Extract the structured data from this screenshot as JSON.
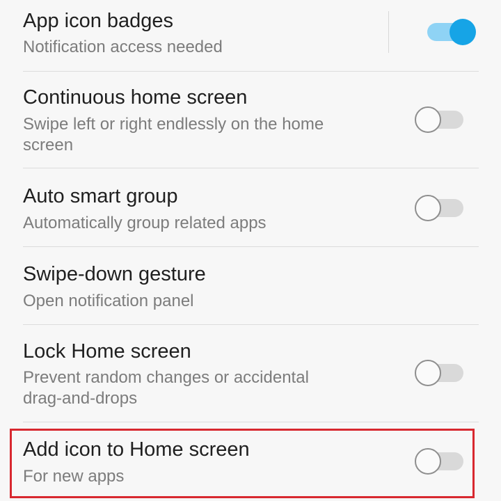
{
  "settings": {
    "items": [
      {
        "title": "App icon badges",
        "subtitle": "Notification access needed",
        "toggle": "on"
      },
      {
        "title": "Continuous home screen",
        "subtitle": "Swipe left or right endlessly on the home screen",
        "toggle": "off"
      },
      {
        "title": "Auto smart group",
        "subtitle": "Automatically group related apps",
        "toggle": "off"
      },
      {
        "title": "Swipe-down gesture",
        "subtitle": "Open notification panel"
      },
      {
        "title": "Lock Home screen",
        "subtitle": "Prevent random changes or accidental drag-and-drops",
        "toggle": "off"
      },
      {
        "title": "Add icon to Home screen",
        "subtitle": "For new apps",
        "toggle": "off"
      }
    ]
  },
  "colors": {
    "toggle_on_knob": "#16a4e6",
    "toggle_on_track": "#8fd3f5",
    "toggle_off_track": "#d9d9d9",
    "highlight_border": "#d8282f"
  }
}
